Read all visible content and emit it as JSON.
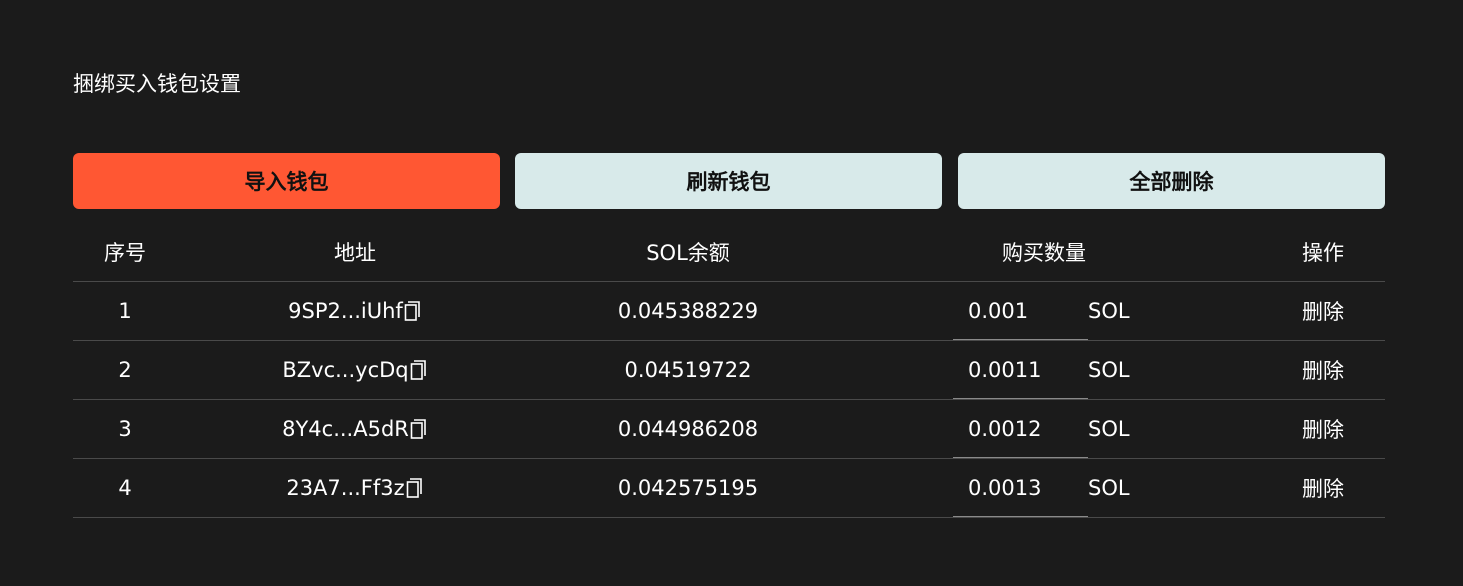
{
  "title": "捆绑买入钱包设置",
  "buttons": {
    "import": "导入钱包",
    "refresh": "刷新钱包",
    "delete_all": "全部删除"
  },
  "colors": {
    "background": "#1b1b1b",
    "primary": "#ff5733",
    "light_button": "#d8eaea"
  },
  "table": {
    "headers": {
      "index": "序号",
      "address": "地址",
      "balance": "SOL余额",
      "quantity": "购买数量",
      "action": "操作"
    },
    "rows": [
      {
        "index": "1",
        "address": "9SP2...iUhf",
        "balance": "0.045388229",
        "quantity": "0.001",
        "unit": "SOL",
        "action": "删除"
      },
      {
        "index": "2",
        "address": "BZvc...ycDq",
        "balance": "0.04519722",
        "quantity": "0.0011",
        "unit": "SOL",
        "action": "删除"
      },
      {
        "index": "3",
        "address": "8Y4c...A5dR",
        "balance": "0.044986208",
        "quantity": "0.0012",
        "unit": "SOL",
        "action": "删除"
      },
      {
        "index": "4",
        "address": "23A7...Ff3z",
        "balance": "0.042575195",
        "quantity": "0.0013",
        "unit": "SOL",
        "action": "删除"
      }
    ]
  },
  "icons": {
    "copy": "copy-icon"
  }
}
